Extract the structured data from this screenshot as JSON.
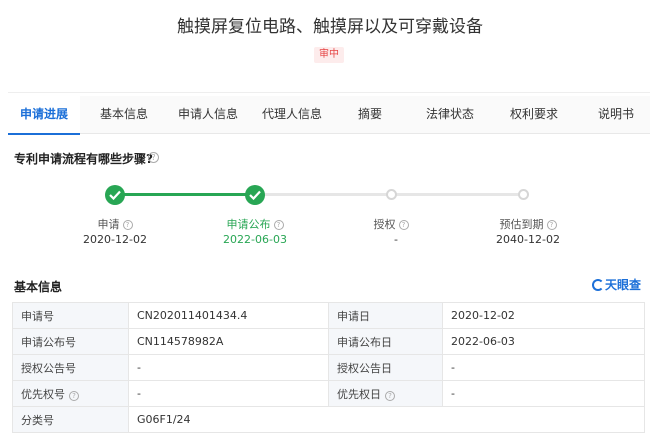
{
  "title": "触摸屏复位电路、触摸屏以及可穿戴设备",
  "status": "审中",
  "tabs": [
    "申请进展",
    "基本信息",
    "申请人信息",
    "代理人信息",
    "摘要",
    "法律状态",
    "权利要求",
    "说明书"
  ],
  "flow": {
    "question": "专利申请流程有哪些步骤?",
    "steps": [
      {
        "label": "申请",
        "date": "2020-12-02",
        "done": true
      },
      {
        "label": "申请公布",
        "date": "2022-06-03",
        "done": true
      },
      {
        "label": "授权",
        "date": "-",
        "done": false
      },
      {
        "label": "预估到期",
        "date": "2040-12-02",
        "done": false
      }
    ]
  },
  "basic": {
    "title": "基本信息",
    "logo": "天眼查",
    "rows": [
      {
        "k1": "申请号",
        "v1": "CN202011401434.4",
        "k2": "申请日",
        "v2": "2020-12-02"
      },
      {
        "k1": "申请公布号",
        "v1": "CN114578982A",
        "k2": "申请公布日",
        "v2": "2022-06-03"
      },
      {
        "k1": "授权公告号",
        "v1": "-",
        "k2": "授权公告日",
        "v2": "-"
      },
      {
        "k1": "优先权号",
        "v1": "-",
        "k2": "优先权日",
        "v2": "-"
      },
      {
        "k1": "分类号",
        "v1": "G06F1/24"
      }
    ]
  }
}
